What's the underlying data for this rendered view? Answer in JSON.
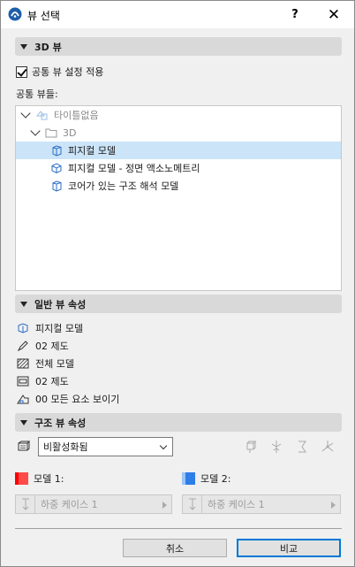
{
  "window": {
    "title": "뷰 선택",
    "help_label": "?",
    "close_label": "✕"
  },
  "section_3d": {
    "title": "3D 뷰"
  },
  "apply_common": {
    "label": "공통 뷰 설정 적용",
    "checked": true
  },
  "common_views_label": "공통 뷰들:",
  "tree": [
    {
      "label": "타이틀없음",
      "icon": "project-icon",
      "indent": 0,
      "expanded": true,
      "muted": true
    },
    {
      "label": "3D",
      "icon": "folder-icon",
      "indent": 1,
      "expanded": true,
      "muted": true
    },
    {
      "label": "피지컬 모델",
      "icon": "3d-view-icon",
      "indent": 2,
      "selected": true
    },
    {
      "label": "피지컬 모델 - 정면 액소노메트리",
      "icon": "axonometric-view-icon",
      "indent": 2
    },
    {
      "label": "코어가 있는 구조 해석 모델",
      "icon": "3d-view-icon",
      "indent": 2
    }
  ],
  "section_general": {
    "title": "일반 뷰 속성"
  },
  "general_props": [
    {
      "label": "피지컬 모델",
      "icon": "model-view-icon"
    },
    {
      "label": "02 제도",
      "icon": "pen-set-icon"
    },
    {
      "label": "전체 모델",
      "icon": "graphic-override-icon"
    },
    {
      "label": "02 제도",
      "icon": "layer-combination-icon"
    },
    {
      "label": "00 모든 요소 보이기",
      "icon": "filter-icon"
    }
  ],
  "section_structural": {
    "title": "구조 뷰 속성"
  },
  "structural": {
    "combo_value": "비활성화됨",
    "model1_label": "모델 1:",
    "model2_label": "모델 2:",
    "model1_colors": [
      "#ff0000",
      "#ff4040"
    ],
    "model2_colors": [
      "#2f7de8",
      "#9cc3f5"
    ],
    "load_case_1": "하중 케이스 1",
    "load_case_2": "하중 케이스 1"
  },
  "buttons": {
    "cancel": "취소",
    "compare": "비교"
  }
}
